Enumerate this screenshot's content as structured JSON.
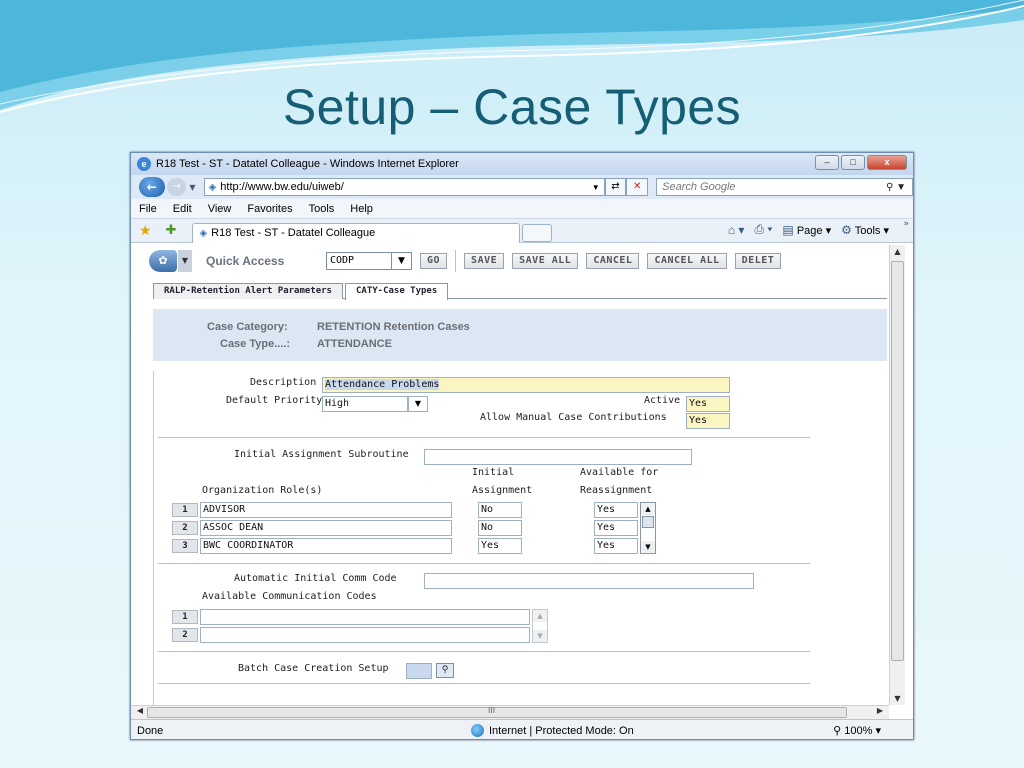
{
  "slide": {
    "title": "Setup – Case Types"
  },
  "window": {
    "title": "R18 Test - ST - Datatel Colleague - Windows Internet Explorer",
    "controls": {
      "minimize": "–",
      "maximize": "□",
      "close": "x"
    }
  },
  "address": {
    "url": "http://www.bw.edu/uiweb/",
    "search_placeholder": "Search Google"
  },
  "menu": [
    "File",
    "Edit",
    "View",
    "Favorites",
    "Tools",
    "Help"
  ],
  "tab": {
    "label": "R18 Test - ST - Datatel Colleague"
  },
  "commandbar": {
    "page": "Page",
    "tools": "Tools"
  },
  "app_toolbar": {
    "quick_access_label": "Quick Access",
    "quick_access_value": "CODP",
    "go": "GO",
    "save": "SAVE",
    "save_all": "SAVE ALL",
    "cancel": "CANCEL",
    "cancel_all": "CANCEL ALL",
    "delete": "DELET"
  },
  "app_tabs": [
    "RALP-Retention Alert Parameters",
    "CATY-Case Types"
  ],
  "case": {
    "category_label": "Case Category:",
    "category_value": "RETENTION Retention Cases",
    "type_label": "Case Type....:",
    "type_value": "ATTENDANCE"
  },
  "form": {
    "description_label": "Description",
    "description_value": "Attendance Problems",
    "priority_label": "Default Priority",
    "priority_value": "High",
    "active_label": "Active",
    "active_value": "Yes",
    "manual_label": "Allow Manual Case Contributions",
    "manual_value": "Yes",
    "init_sub_label": "Initial Assignment Subroutine",
    "init_sub_value": "",
    "col_initial_1": "Initial",
    "col_initial_2": "Assignment",
    "col_avail_1": "Available for",
    "col_avail_2": "Reassignment",
    "roles_label": "Organization Role(s)",
    "roles": [
      {
        "num": "1",
        "role": "ADVISOR",
        "initial": "No",
        "reassign": "Yes"
      },
      {
        "num": "2",
        "role": "ASSOC DEAN",
        "initial": "No",
        "reassign": "Yes"
      },
      {
        "num": "3",
        "role": "BWC COORDINATOR",
        "initial": "Yes",
        "reassign": "Yes"
      }
    ],
    "auto_comm_label": "Automatic Initial Comm Code",
    "auto_comm_value": "",
    "avail_comm_label": "Available Communication Codes",
    "comm_codes": [
      {
        "num": "1",
        "value": ""
      },
      {
        "num": "2",
        "value": ""
      }
    ],
    "batch_label": "Batch Case Creation Setup",
    "batch_value": ""
  },
  "statusbar": {
    "done": "Done",
    "zone": "Internet | Protected Mode: On",
    "zoom": "100%"
  },
  "scroll": {
    "h_grip": "III"
  },
  "colors": {
    "title": "#155e74",
    "yellow_field": "#fbf5c2",
    "case_panel": "#dbe8f4"
  }
}
